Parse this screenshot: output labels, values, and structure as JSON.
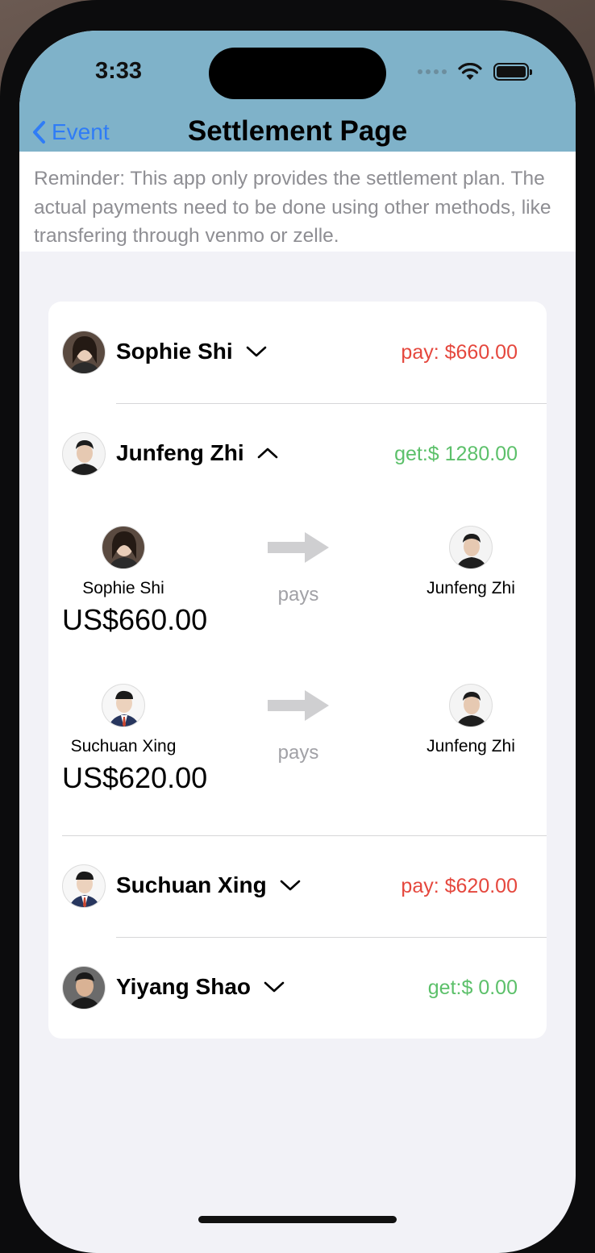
{
  "status_bar": {
    "time": "3:33"
  },
  "nav": {
    "back_label": "Event",
    "title": "Settlement Page"
  },
  "reminder": "Reminder: This app only provides the settlement plan. The actual payments need to be done using other methods, like transfering through venmo or zelle.",
  "members": [
    {
      "name": "Sophie Shi",
      "amount": "pay: $660.00",
      "kind": "pay",
      "expanded": false
    },
    {
      "name": "Junfeng Zhi",
      "amount": "get:$ 1280.00",
      "kind": "get",
      "expanded": true
    },
    {
      "name": "Suchuan Xing",
      "amount": "pay: $620.00",
      "kind": "pay",
      "expanded": false
    },
    {
      "name": "Yiyang Shao",
      "amount": "get:$ 0.00",
      "kind": "get",
      "expanded": false
    }
  ],
  "transactions": [
    {
      "from": "Sophie Shi",
      "verb": "pays",
      "to": "Junfeng Zhi",
      "amount": "US$660.00"
    },
    {
      "from": "Suchuan Xing",
      "verb": "pays",
      "to": "Junfeng Zhi",
      "amount": "US$620.00"
    }
  ],
  "colors": {
    "header": "#7fb2c9",
    "accent": "#2f7cf6",
    "pay": "#e5473d",
    "get": "#5cc06a"
  },
  "icons": [
    "back-chevron-icon",
    "wifi-icon",
    "battery-icon",
    "chevron-down-icon",
    "chevron-up-icon",
    "arrow-right-icon"
  ]
}
